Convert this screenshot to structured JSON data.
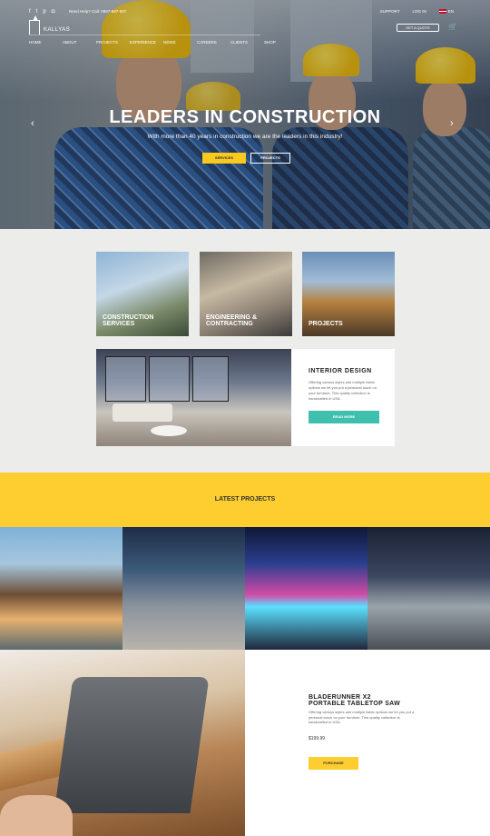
{
  "header": {
    "phone_text": "Need Help? Call: 0987-987-987",
    "top_links": [
      "SUPPORT",
      "LOG IN"
    ],
    "language": "EN",
    "logo_text": "KALLYAS",
    "quote_button": "GET A QUOTE",
    "nav": [
      "HOME",
      "ABOUT",
      "PROJECTS",
      "EXPERIENCE",
      "NEWS",
      "CAREERS",
      "CLIENTS",
      "SHOP"
    ]
  },
  "hero": {
    "title": "LEADERS IN CONSTRUCTION",
    "subtitle": "With more than 40 years in construction  we are the leaders in this industry!",
    "btn_services": "SERVICES",
    "btn_projects": "PROJECTS",
    "prev": "‹",
    "next": "›"
  },
  "services": {
    "tiles": [
      {
        "line1": "CONSTRUCTION",
        "line2": "SERVICES"
      },
      {
        "line1": "ENGINEERING &",
        "line2": "CONTRACTING"
      },
      {
        "line1": "PROJECTS",
        "line2": ""
      }
    ],
    "interior": {
      "title": "INTERIOR DESIGN",
      "text": "Offering various styles and multiple fabric options  we let you put a personal touch on your furniture. This quality collection is handcrafted in USA.",
      "button": "READ MORE"
    }
  },
  "latest": {
    "title": "LATEST PROJECTS"
  },
  "product": {
    "title_line1": "BLADERUNNER X2",
    "title_line2": "PORTABLE TABLETOP SAW",
    "text": "Offering various styles and multiple fabric options  we let you put a personal touch on your furniture. This quality collection is handcrafted in USA.",
    "price": "$199.99",
    "button": "PURCHASE"
  },
  "icons": {
    "social": [
      "facebook-icon",
      "twitter-icon",
      "pinterest-icon",
      "instagram-icon"
    ],
    "cart": "cart-icon"
  },
  "colors": {
    "accent_yellow": "#fecd2f",
    "accent_teal": "#3fbfad"
  }
}
